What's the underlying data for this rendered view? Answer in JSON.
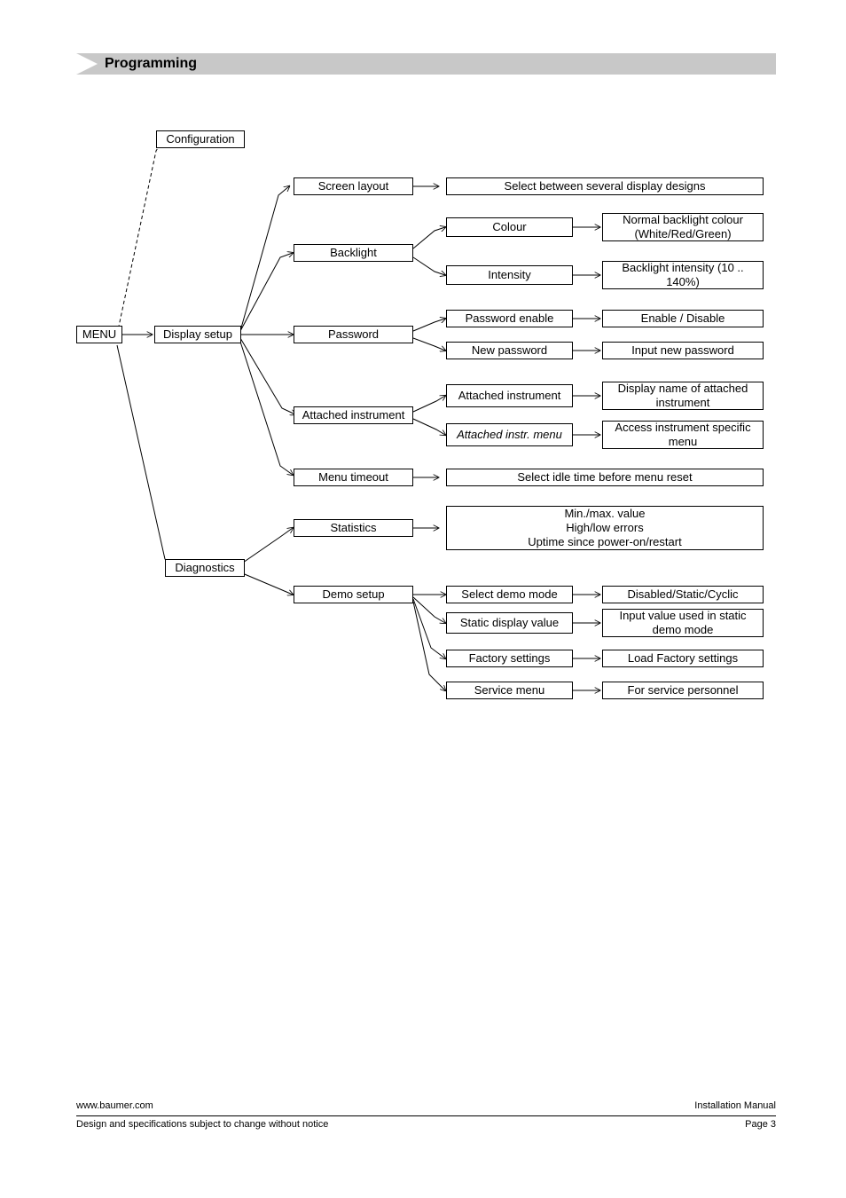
{
  "header": {
    "title": "Programming"
  },
  "nodes": {
    "menu": "MENU",
    "configuration": "Configuration",
    "displaySetup": "Display setup",
    "diagnostics": "Diagnostics",
    "screenLayout": "Screen layout",
    "screenLayoutDesc": "Select between several display designs",
    "backlight": "Backlight",
    "colour": "Colour",
    "colourDesc": "Normal backlight colour (White/Red/Green)",
    "intensity": "Intensity",
    "intensityDesc": "Backlight intensity (10 .. 140%)",
    "password": "Password",
    "passwordEnable": "Password enable",
    "passwordEnableDesc": "Enable / Disable",
    "newPassword": "New password",
    "newPasswordDesc": "Input new password",
    "attachedInstrument": "Attached instrument",
    "attachedInstrumentSub": "Attached instrument",
    "attachedInstrumentDesc": "Display name of attached instrument",
    "attachedInstrMenu": "Attached instr. menu",
    "attachedInstrMenuDesc": "Access instrument specific menu",
    "menuTimeout": "Menu timeout",
    "menuTimeoutDesc": "Select idle time before menu reset",
    "statistics": "Statistics",
    "statisticsDesc1": "Min./max. value",
    "statisticsDesc2": "High/low errors",
    "statisticsDesc3": "Uptime since power-on/restart",
    "demoSetup": "Demo setup",
    "selectDemoMode": "Select demo mode",
    "selectDemoModeDesc": "Disabled/Static/Cyclic",
    "staticDisplayValue": "Static display value",
    "staticDisplayValueDesc": "Input value used in static demo mode",
    "factorySettings": "Factory settings",
    "factorySettingsDesc": "Load Factory settings",
    "serviceMenu": "Service menu",
    "serviceMenuDesc": "For service personnel"
  },
  "footer": {
    "url": "www.baumer.com",
    "docType": "Installation Manual",
    "disclaimer": "Design and specifications subject to change without notice",
    "page": "Page  3"
  }
}
